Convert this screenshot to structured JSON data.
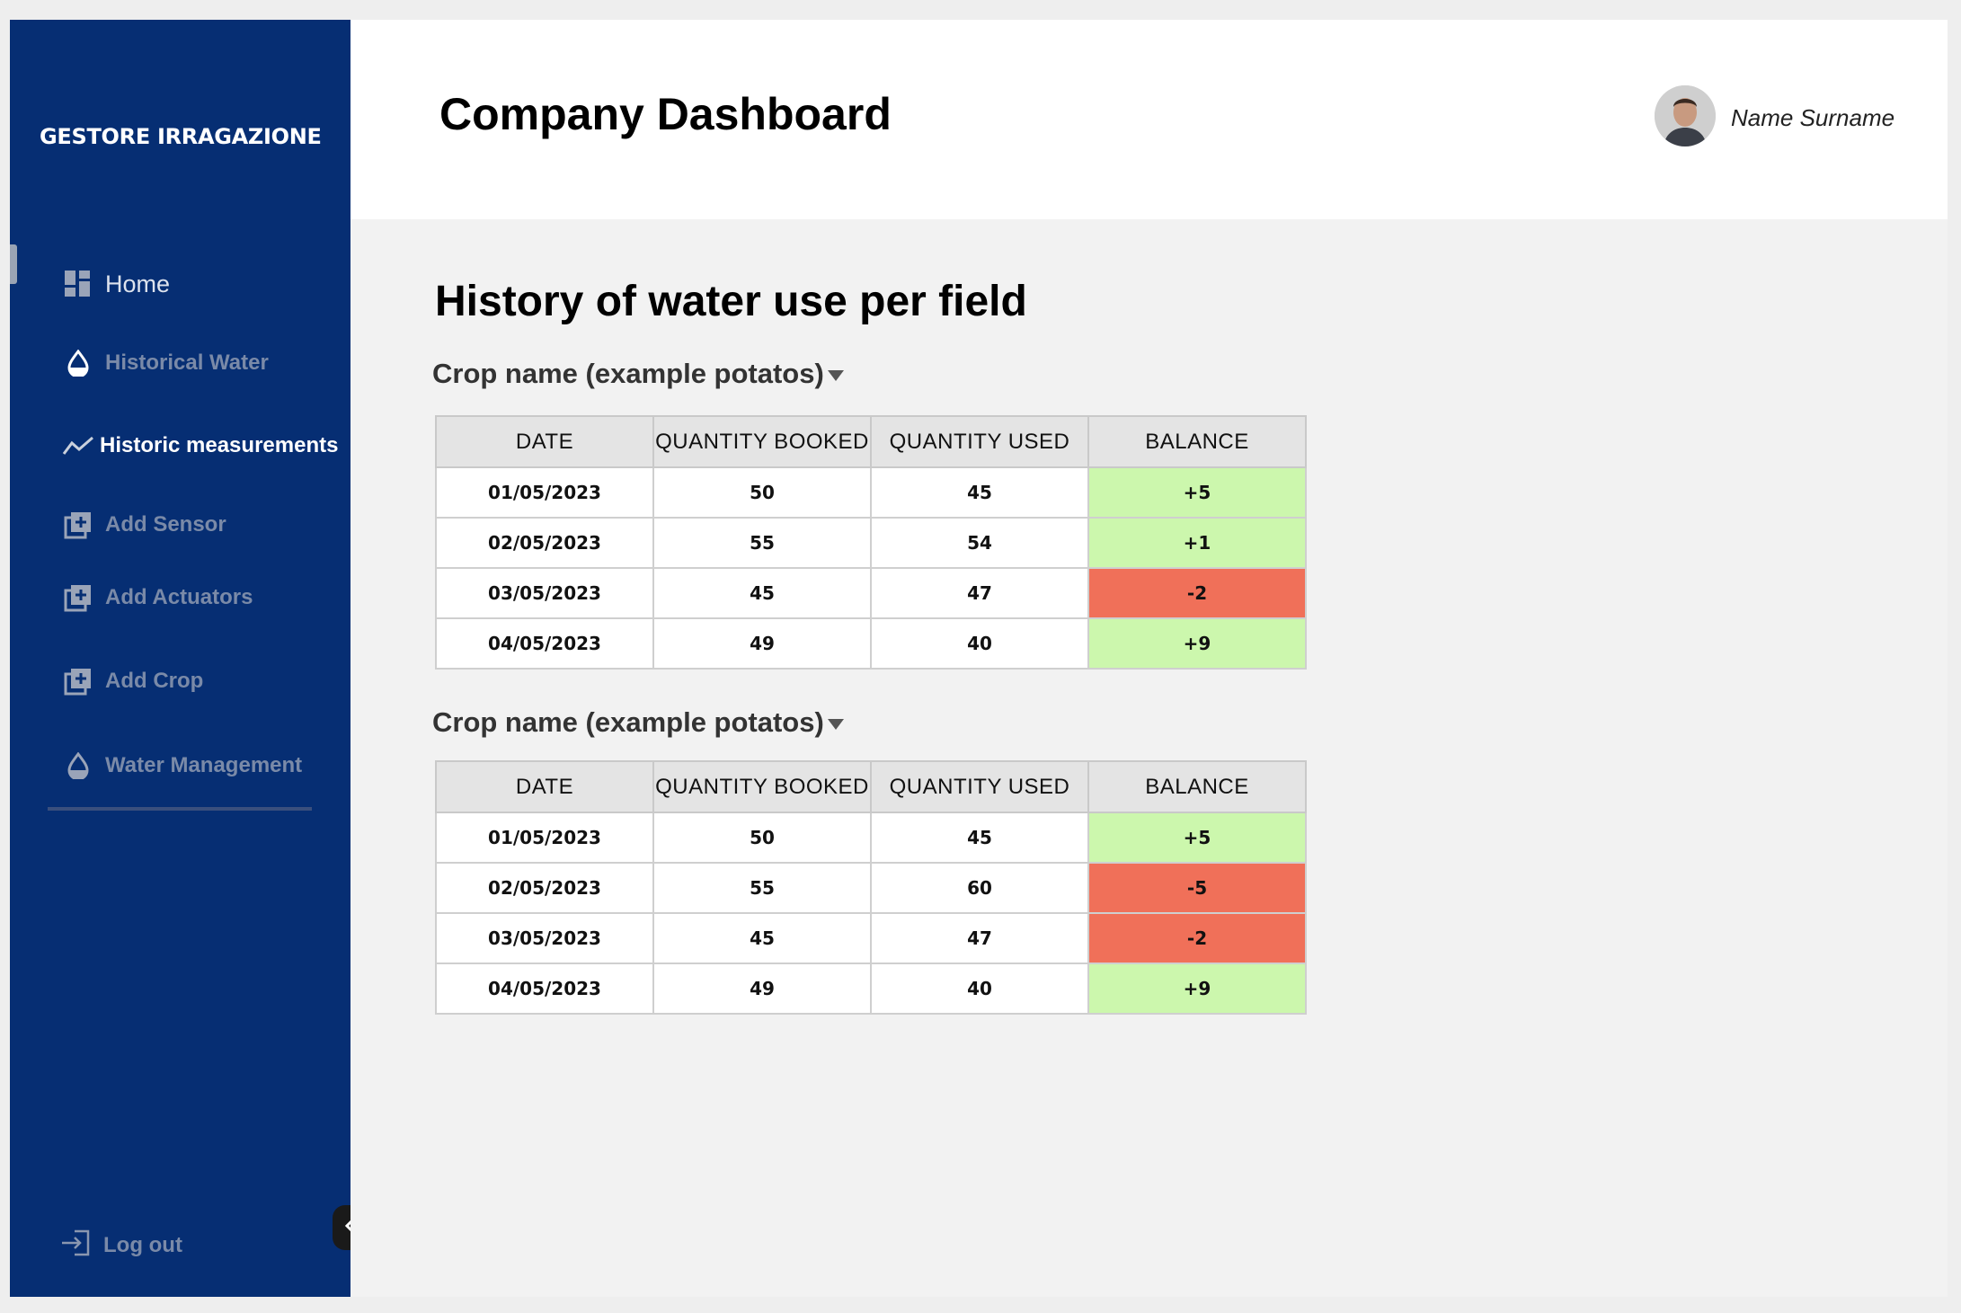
{
  "brand": "GESTORE IRRAGAZIONE",
  "sidebar": {
    "items": [
      {
        "label": "Home",
        "icon": "dashboard-icon"
      },
      {
        "label": "Historical Water",
        "icon": "water-drop-icon"
      },
      {
        "label": "Historic measurements",
        "icon": "trend-line-icon"
      },
      {
        "label": "Add Sensor",
        "icon": "add-box-icon"
      },
      {
        "label": "Add Actuators",
        "icon": "add-box-icon"
      },
      {
        "label": "Add Crop",
        "icon": "add-box-icon"
      },
      {
        "label": "Water Management",
        "icon": "water-drop-icon"
      }
    ],
    "logout": "Log out"
  },
  "header": {
    "title": "Company Dashboard",
    "user_name": "Name Surname"
  },
  "main": {
    "title": "History of water use per field",
    "columns": [
      "DATE",
      "QUANTITY BOOKED",
      "QUANTITY USED",
      "BALANCE"
    ],
    "tables": [
      {
        "crop_label": "Crop name (example potatos)",
        "rows": [
          {
            "date": "01/05/2023",
            "booked": "50",
            "used": "45",
            "balance": "+5"
          },
          {
            "date": "02/05/2023",
            "booked": "55",
            "used": "54",
            "balance": "+1"
          },
          {
            "date": "03/05/2023",
            "booked": "45",
            "used": "47",
            "balance": "-2"
          },
          {
            "date": "04/05/2023",
            "booked": "49",
            "used": "40",
            "balance": "+9"
          }
        ]
      },
      {
        "crop_label": "Crop name (example potatos)",
        "rows": [
          {
            "date": "01/05/2023",
            "booked": "50",
            "used": "45",
            "balance": "+5"
          },
          {
            "date": "02/05/2023",
            "booked": "55",
            "used": "60",
            "balance": "-5"
          },
          {
            "date": "03/05/2023",
            "booked": "45",
            "used": "47",
            "balance": "-2"
          },
          {
            "date": "04/05/2023",
            "booked": "49",
            "used": "40",
            "balance": "+9"
          }
        ]
      }
    ]
  },
  "colors": {
    "sidebar_bg": "#062e73",
    "positive": "#ccf7ad",
    "negative": "#f07059"
  }
}
